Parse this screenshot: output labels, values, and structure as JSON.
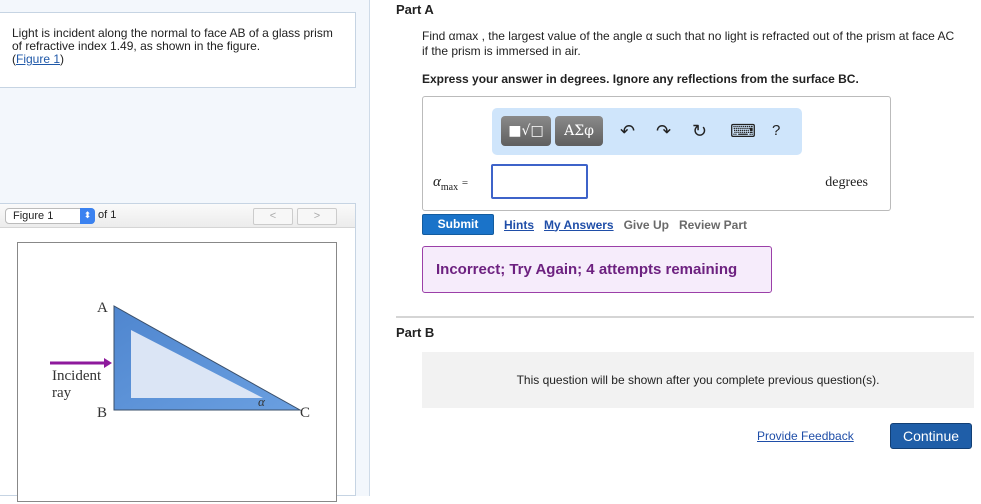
{
  "problem": {
    "text": "Light is incident along the normal to face AB of a glass prism of refractive index 1.49, as shown in the figure.",
    "figure_link": "Figure 1"
  },
  "figure": {
    "selector": "Figure 1",
    "of": "of 1",
    "prev": "<",
    "next": ">",
    "labels": {
      "a": "A",
      "b": "B",
      "c": "C",
      "alpha": "α",
      "incident": "Incident",
      "ray": "ray"
    },
    "colors": {
      "ray": "#8e1a9c",
      "prism": "#5b93d6"
    }
  },
  "partA": {
    "title": "Part A",
    "question": "Find αmax , the largest value of the angle α such that no light is refracted out of the prism at face AC if the prism is immersed in air.",
    "instructions": "Express your answer in degrees. Ignore any reflections from the surface BC.",
    "toolbar": {
      "templates": "■√□",
      "greek": "ΑΣφ",
      "undo": "↶",
      "redo": "↷",
      "reset": "↻",
      "keyboard": "⌨",
      "help": "?"
    },
    "answer_label": "α",
    "answer_sub": "max",
    "equals": "=",
    "answer_value": "",
    "units": "degrees",
    "actions": {
      "submit": "Submit",
      "hints": "Hints",
      "my_answers": "My Answers",
      "give_up": "Give Up",
      "review": "Review Part"
    },
    "feedback": "Incorrect; Try Again; 4 attempts remaining"
  },
  "partB": {
    "title": "Part B",
    "locked": "This question will be shown after you complete previous question(s)."
  },
  "footer": {
    "feedback": "Provide Feedback",
    "continue": "Continue"
  }
}
